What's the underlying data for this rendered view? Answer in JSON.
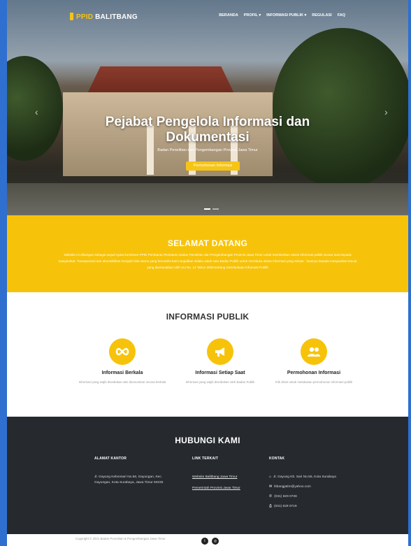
{
  "nav": {
    "brand_prefix": "PPID",
    "brand_name": "BALITBANG",
    "menu": [
      "BERANDA",
      "PROFIL ▾",
      "INFORMASI PUBLIK ▾",
      "REGULASI",
      "FAQ"
    ]
  },
  "hero": {
    "title_line1": "Pejabat Pengelola Informasi dan",
    "title_line2": "Dokumentasi",
    "subtitle": "Badan Penelitian dan Pengembangan Provinsi Jawa Timur",
    "button": "Permohonan Informasi",
    "prev_icon": "chevron-left-icon",
    "next_icon": "chevron-right-icon"
  },
  "welcome": {
    "title": "SELAMAT DATANG",
    "text": "Website ini dibangun sebagai wujud nyata komitmen PPID Pembantu Pembantu Badan Penelitian dan Pengembangan Provinsi Jawa Timur untuk memberikan akses informasi publik secara luas kepada masyarakat. Transparansi dan akuntabilitas menjadi nilai utama yang berusaha kami wujudkan selaku salah satu Badan Publik untuk membuka akses informasi yang seluas - luasnya kepada masyarakat sesuai yang diamanatkan oleh UU No. 14 Tahun 2008 tentang Keterbukaan Informasi Publik"
  },
  "info": {
    "title": "INFORMASI PUBLIK",
    "items": [
      {
        "icon": "infinity-icon",
        "title": "Informasi Berkala",
        "desc": "Informasi yang wajib disediakan dan diumumkan secara berkala"
      },
      {
        "icon": "megaphone-icon",
        "title": "Informasi Setiap Saat",
        "desc": "Informasi yang wajib disediakan oleh Badan Publik"
      },
      {
        "icon": "users-icon",
        "title": "Permohonan Informasi",
        "desc": "Klik disini untuk melakukan permohonan informasi publik"
      }
    ]
  },
  "contact": {
    "title": "HUBUNGI KAMI",
    "office_heading": "ALAMAT KANTOR",
    "office_text": "Jl. Gayung Kebonsari No.56, Gayungan, Kec. Gayungan, Kota Surabaya, Jawa Timur 60235",
    "links_heading": "LINK TERKAIT",
    "links": [
      "Website Balitbang Jawa Timur",
      "Pemerintah Provinsi Jawa Timur"
    ],
    "contact_heading": "KONTAK",
    "address": "Jl. Gayung Kb. Sari No.56, Kota Surabaya",
    "email": "litbangjatim@yahoo.com",
    "phone": "(031) 829 0738",
    "fax": "(031) 829 0719"
  },
  "footer": {
    "copyright": "Copyright © 2021 Badan Penelitian & Pengembangan Jawa Timur",
    "social": [
      "twitter-icon",
      "instagram-icon"
    ]
  },
  "colors": {
    "accent": "#f7c30a",
    "dark": "#262a2f",
    "frame": "#2f6fd0"
  }
}
